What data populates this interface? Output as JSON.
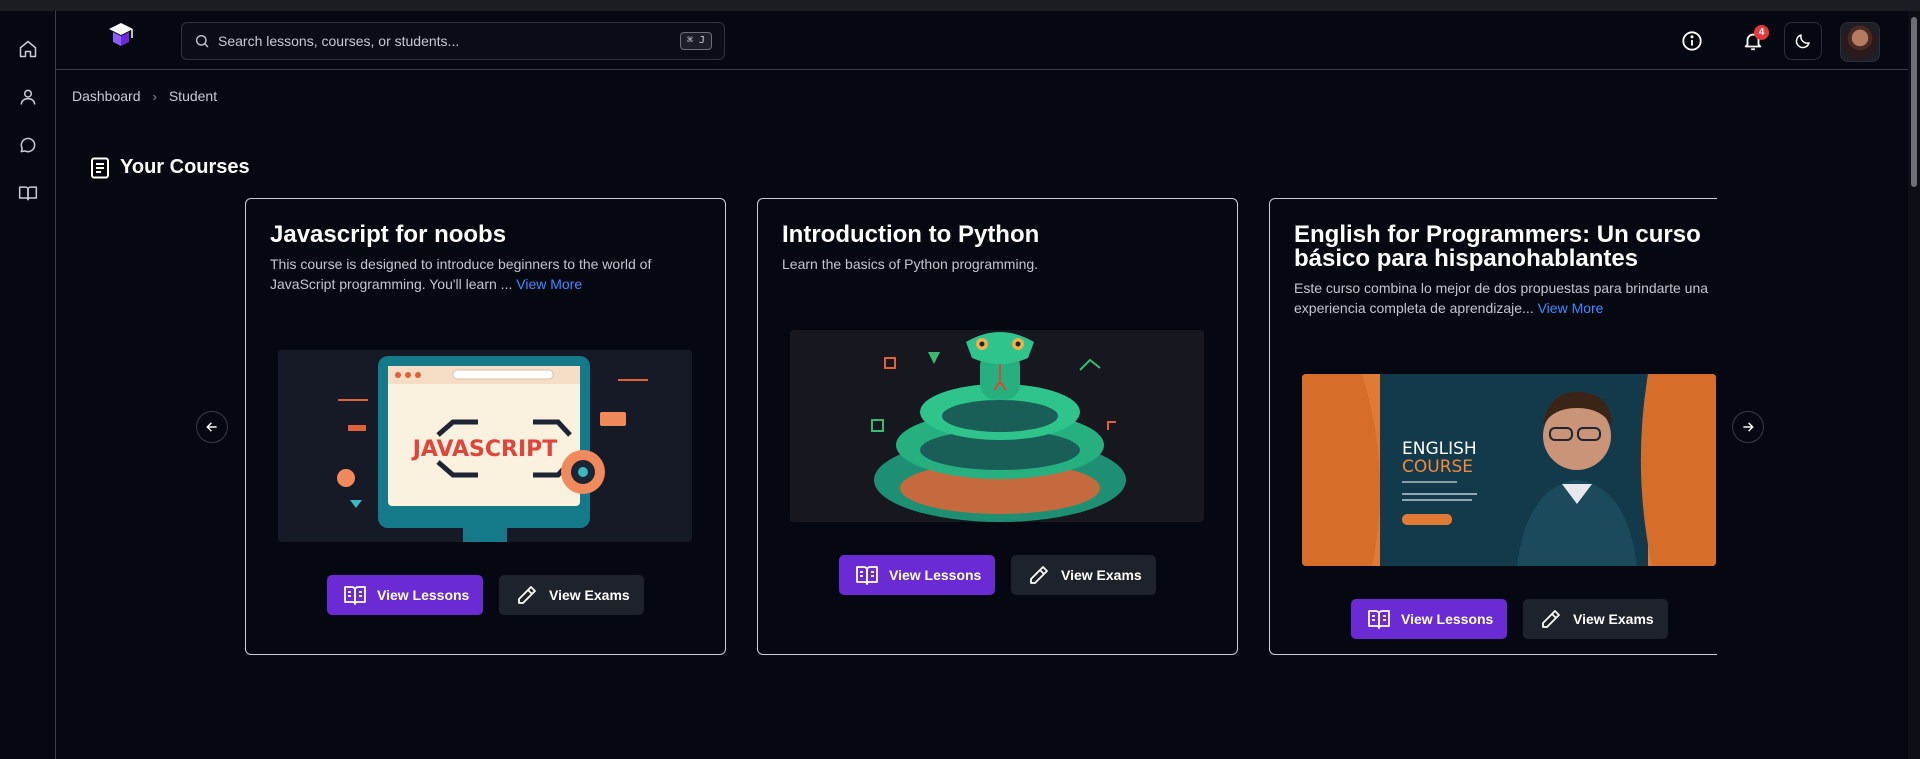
{
  "search": {
    "placeholder": "Search lessons, courses, or students...",
    "shortcut": "⌘ J"
  },
  "notifications": {
    "count": "4"
  },
  "breadcrumb": {
    "items": [
      "Dashboard",
      "Student"
    ]
  },
  "section": {
    "title": "Your Courses"
  },
  "courses": [
    {
      "title": "Javascript for noobs",
      "description": "This course is designed to introduce beginners to the world of JavaScript programming. You'll learn ...",
      "view_more": "View More",
      "image_text": "JAVASCRIPT",
      "lessons_label": "View Lessons",
      "exams_label": "View Exams"
    },
    {
      "title": "Introduction to Python",
      "description": "Learn the basics of Python programming.",
      "lessons_label": "View Lessons",
      "exams_label": "View Exams"
    },
    {
      "title": "English for Programmers: Un curso básico para hispanohablantes",
      "description": "Este curso combina lo mejor de dos propuestas para brindarte una experiencia completa de aprendizaje...",
      "view_more": "View More",
      "image_text_line1": "ENGLISH",
      "image_text_line2": "COURSE",
      "lessons_label": "View Lessons",
      "exams_label": "View Exams"
    }
  ],
  "colors": {
    "primary_button": "#6a2ad4",
    "link": "#3b8cff",
    "badge": "#e5383b",
    "background": "#050810"
  },
  "icons": {
    "sidebar": [
      "home-icon",
      "user-icon",
      "chat-icon",
      "book-icon"
    ],
    "topbar": [
      "info-icon",
      "bell-icon",
      "moon-icon"
    ]
  }
}
